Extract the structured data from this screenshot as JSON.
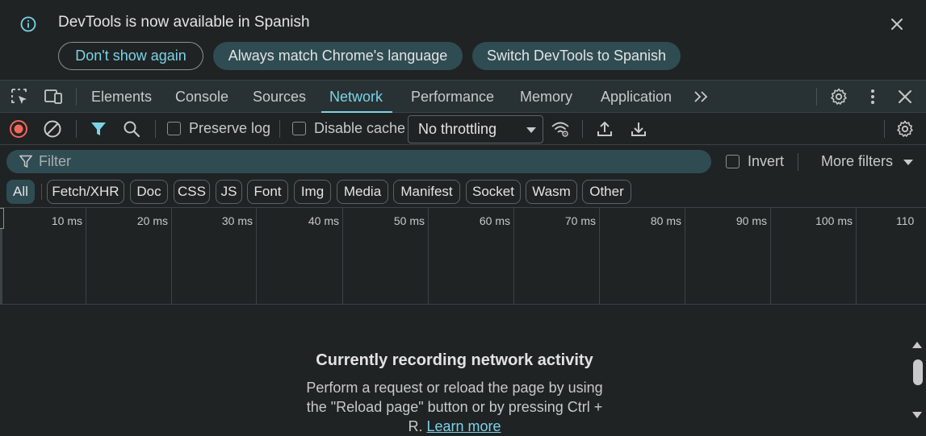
{
  "infobar": {
    "message": "DevTools is now available in Spanish",
    "buttons": {
      "dont_show": "Don't show again",
      "always_match": "Always match Chrome's language",
      "switch": "Switch DevTools to Spanish"
    },
    "icons": {
      "info": "info-icon",
      "close": "close-icon"
    }
  },
  "tabbar": {
    "tabs": [
      "Elements",
      "Console",
      "Sources",
      "Network",
      "Performance",
      "Memory",
      "Application"
    ],
    "active_tab": "Network",
    "icons": [
      "select-element-icon",
      "device-toolbar-icon",
      "more-tabs-icon",
      "settings-icon",
      "kebab-menu-icon",
      "close-devtools-icon"
    ]
  },
  "network_toolbar": {
    "preserve_log": "Preserve log",
    "preserve_log_checked": false,
    "disable_cache": "Disable cache",
    "disable_cache_checked": false,
    "throttling": "No throttling",
    "icons": [
      "record-stop-icon",
      "clear-icon",
      "filter-icon",
      "search-icon",
      "network-conditions-icon",
      "import-har-icon",
      "export-har-icon",
      "network-settings-icon"
    ]
  },
  "filter": {
    "placeholder": "Filter",
    "value": "",
    "invert": "Invert",
    "invert_checked": false,
    "more_filters": "More filters"
  },
  "type_chips": {
    "items": [
      "All",
      "Fetch/XHR",
      "Doc",
      "CSS",
      "JS",
      "Font",
      "Img",
      "Media",
      "Manifest",
      "Socket",
      "Wasm",
      "Other"
    ],
    "active": "All"
  },
  "timeline": {
    "ticks": [
      "10 ms",
      "20 ms",
      "30 ms",
      "40 ms",
      "50 ms",
      "60 ms",
      "70 ms",
      "80 ms",
      "90 ms",
      "100 ms",
      "110"
    ]
  },
  "empty_state": {
    "title": "Currently recording network activity",
    "body": "Perform a request or reload the page by using the \"Reload page\" button or by pressing Ctrl + R.",
    "link": "Learn more"
  },
  "colors": {
    "accent": "#7cd3e6",
    "background": "#1f2324",
    "toolbar": "#283235",
    "chip_active": "#2f4c52",
    "record_red": "#f2665a"
  }
}
